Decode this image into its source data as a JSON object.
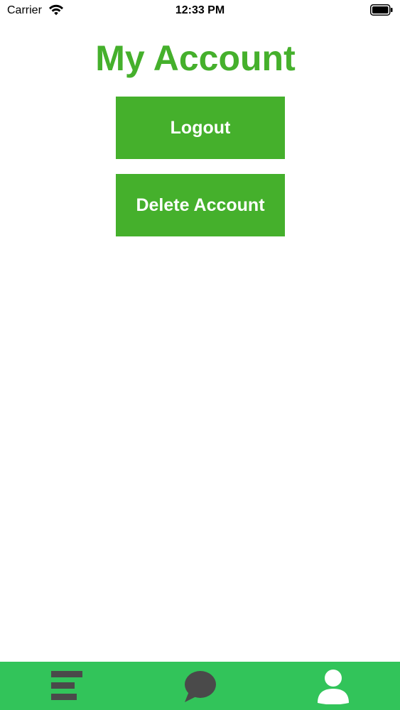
{
  "status_bar": {
    "carrier": "Carrier",
    "time": "12:33 PM",
    "wifi_icon": "wifi-icon",
    "battery_icon": "battery-icon"
  },
  "page": {
    "title": "My Account"
  },
  "buttons": {
    "logout_label": "Logout",
    "delete_account_label": "Delete Account"
  },
  "tab_bar": {
    "items": [
      {
        "icon": "menu-icon"
      },
      {
        "icon": "chat-bubble-icon"
      },
      {
        "icon": "profile-icon",
        "selected": true
      }
    ]
  },
  "colors": {
    "accent_green": "#45b02c",
    "tab_bar_green": "#32c45a",
    "tab_icon_inactive": "#4a4a4a",
    "tab_icon_active": "#ffffff"
  }
}
